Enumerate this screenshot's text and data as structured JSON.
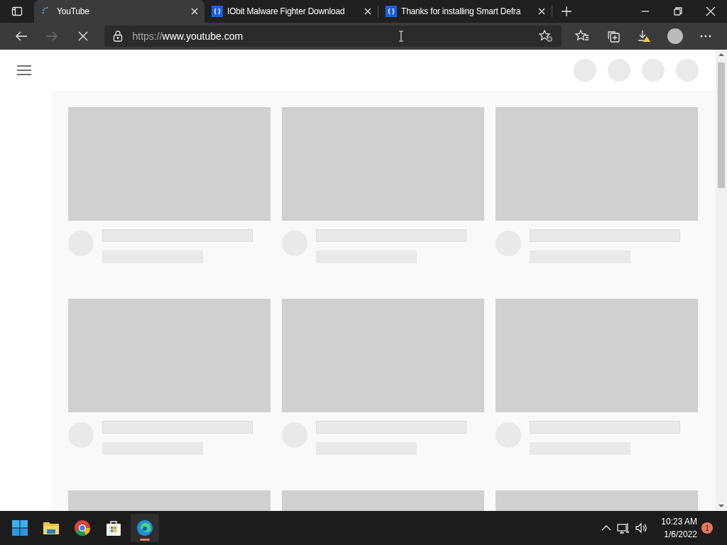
{
  "tabs": [
    {
      "title": "YouTube",
      "selected": true,
      "kind": "loading"
    },
    {
      "title": "IObit Malware Fighter Download",
      "selected": false,
      "kind": "site"
    },
    {
      "title": "Thanks for installing Smart Defra",
      "selected": false,
      "kind": "site"
    }
  ],
  "address_bar": {
    "url": "https://**www.youtube.com**"
  },
  "taskbar": {
    "apps": [
      {
        "kind": "start",
        "active": false
      },
      {
        "kind": "files",
        "active": false
      },
      {
        "kind": "chrome",
        "active": false
      },
      {
        "kind": "store",
        "active": false
      },
      {
        "kind": "edge",
        "active": true
      }
    ],
    "time": "10:23 AM",
    "date": "1/6/2022",
    "notification_count": "1"
  }
}
